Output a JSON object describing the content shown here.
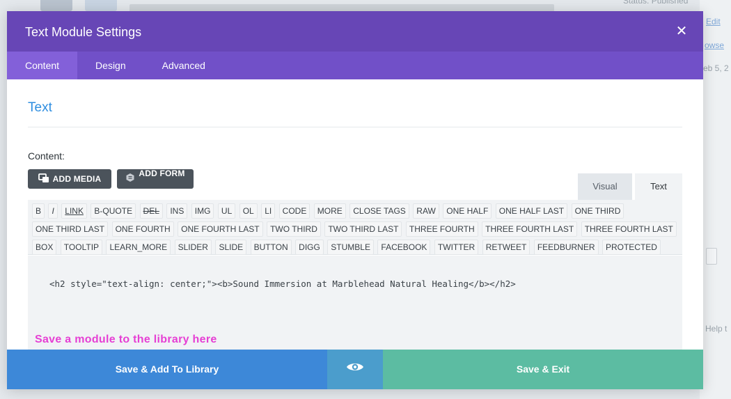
{
  "background": {
    "status_text": "Status: Published",
    "edit_link": "Edit",
    "browse_link": "owse",
    "date_fragment": "eb 5, 2",
    "help_fragment": "Help t"
  },
  "modal": {
    "title": "Text Module Settings",
    "tabs": [
      {
        "label": "Content",
        "active": true
      },
      {
        "label": "Design",
        "active": false
      },
      {
        "label": "Advanced",
        "active": false
      }
    ],
    "section_title": "Text",
    "content_label": "Content:",
    "add_media_label": "ADD MEDIA",
    "add_form_label": "ADD FORM",
    "editor_tabs": {
      "visual": "Visual",
      "text": "Text"
    },
    "quicktags": [
      "B",
      "I",
      "LINK",
      "B-QUOTE",
      "DEL",
      "INS",
      "IMG",
      "UL",
      "OL",
      "LI",
      "CODE",
      "MORE",
      "CLOSE TAGS",
      "RAW",
      "ONE HALF",
      "ONE HALF LAST",
      "ONE THIRD",
      "ONE THIRD LAST",
      "ONE FOURTH",
      "ONE FOURTH LAST",
      "TWO THIRD",
      "TWO THIRD LAST",
      "THREE FOURTH",
      "THREE FOURTH LAST",
      "THREE FOURTH LAST",
      "BOX",
      "TOOLTIP",
      "LEARN_MORE",
      "SLIDER",
      "SLIDE",
      "BUTTON",
      "DIGG",
      "STUMBLE",
      "FACEBOOK",
      "TWITTER",
      "RETWEET",
      "FEEDBURNER",
      "PROTECTED"
    ],
    "code_content": "<h2 style=\"text-align: center;\"><b>Sound Immersion at Marblehead Natural Healing</b></h2>",
    "annotation": "Save a module to the library here",
    "footer": {
      "save_library": "Save & Add To Library",
      "save_exit": "Save & Exit"
    }
  },
  "colors": {
    "header": "#6746b6",
    "tabs_bar": "#7150c8",
    "active_tab": "#8360d9",
    "save_library": "#3d88d8",
    "preview": "#4b9dcc",
    "save_exit": "#5cbca2",
    "annotation": "#e63fd4"
  },
  "icons": {
    "close": "close-icon",
    "media": "media-icon",
    "form": "form-icon",
    "preview": "eye-icon"
  }
}
